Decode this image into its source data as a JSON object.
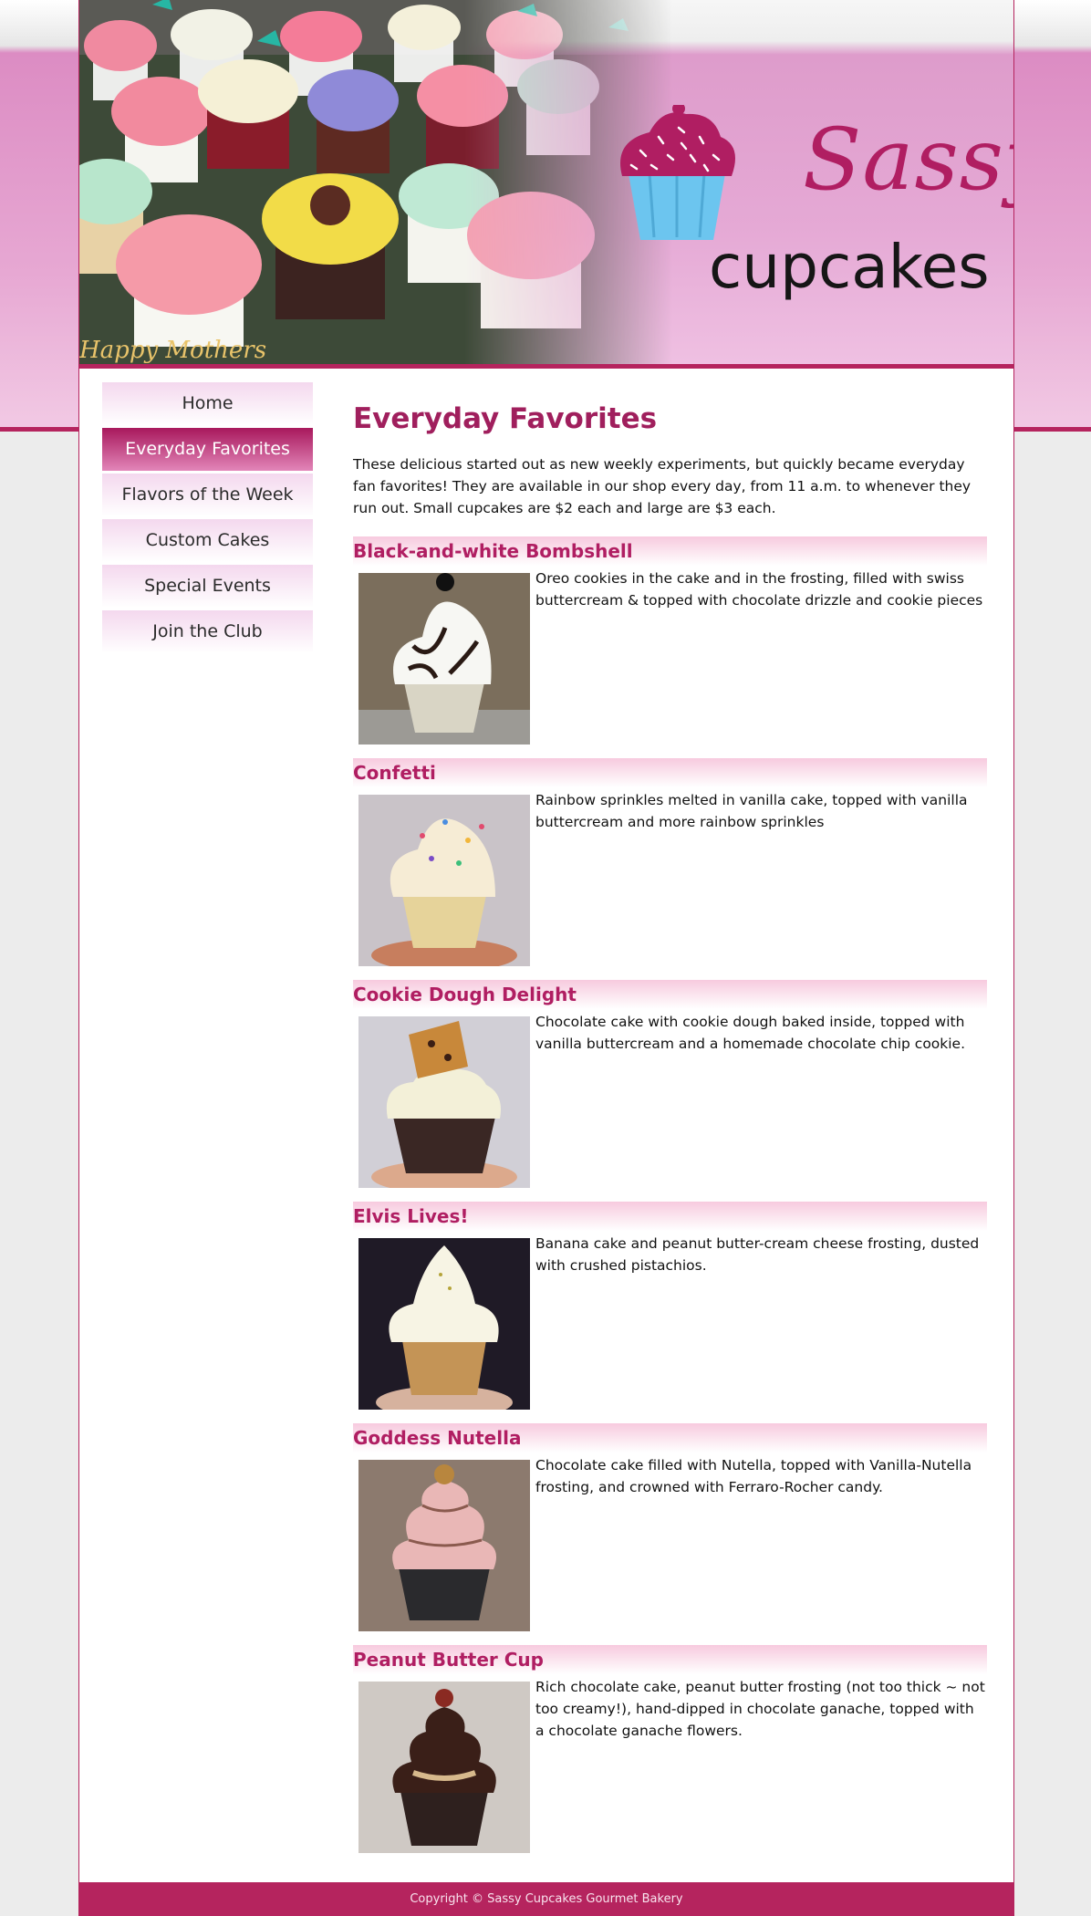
{
  "site": {
    "logo_script": "Sassy",
    "logo_word": "cupcakes",
    "photo_text": "Happy Mothers"
  },
  "nav": {
    "items": [
      {
        "label": "Home",
        "active": false
      },
      {
        "label": "Everyday Favorites",
        "active": true
      },
      {
        "label": "Flavors of the Week",
        "active": false
      },
      {
        "label": "Custom Cakes",
        "active": false
      },
      {
        "label": "Special Events",
        "active": false
      },
      {
        "label": "Join the Club",
        "active": false
      }
    ]
  },
  "main": {
    "title": "Everyday Favorites",
    "intro": "These delicious started out as new weekly experiments, but quickly became everyday fan favorites! They are available in our shop every day, from 11 a.m. to whenever they run out. Small cupcakes are $2 each and large are $3 each.",
    "items": [
      {
        "name": "Black-and-white Bombshell",
        "description": "Oreo cookies in the cake and in the frosting, filled with swiss buttercream & topped with chocolate drizzle and cookie pieces"
      },
      {
        "name": "Confetti",
        "description": "Rainbow sprinkles melted in vanilla cake, topped with vanilla buttercream and more rainbow sprinkles"
      },
      {
        "name": "Cookie Dough Delight",
        "description": "Chocolate cake with cookie dough baked inside, topped with vanilla buttercream and a homemade chocolate chip cookie."
      },
      {
        "name": "Elvis Lives!",
        "description": "Banana cake and peanut butter-cream cheese frosting, dusted with crushed pistachios."
      },
      {
        "name": "Goddess Nutella",
        "description": "Chocolate cake filled with Nutella, topped with Vanilla-Nutella frosting, and crowned with Ferraro-Rocher candy."
      },
      {
        "name": "Peanut Butter Cup",
        "description": "Rich chocolate cake, peanut butter frosting (not too thick ~ not too creamy!), hand-dipped in chocolate ganache, topped with a chocolate ganache flowers."
      }
    ]
  },
  "footer": {
    "copyright": "Copyright © Sassy Cupcakes Gourmet Bakery"
  },
  "colors": {
    "brand": "#b5245e",
    "title": "#a01f5d",
    "nav_active": "#a8185c"
  },
  "icons": [
    "cupcake-logo-icon"
  ]
}
